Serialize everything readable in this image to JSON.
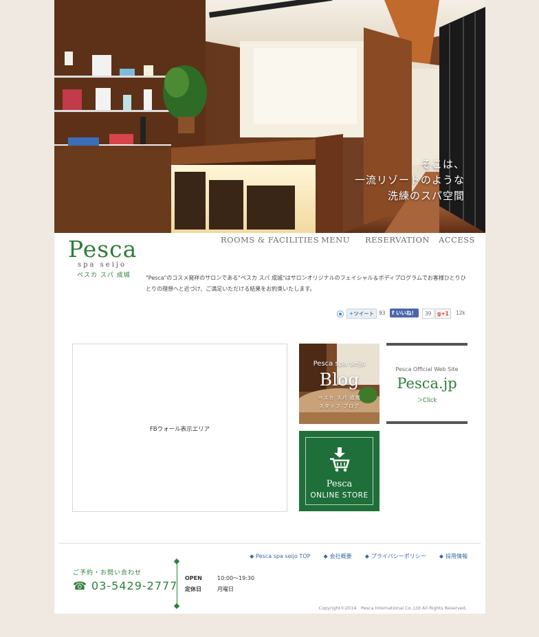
{
  "hero": {
    "tagline_line1": "そこは、",
    "tagline_line2": "一流リゾートのような",
    "tagline_line3": "洗練のスパ空間"
  },
  "logo": {
    "word": "Pesca",
    "sub": "spa seijo",
    "jp": "ペスカ スパ 成城"
  },
  "nav": {
    "items": [
      "ROOMS & FACILITIES",
      "MENU",
      "RESERVATION",
      "ACCESS"
    ]
  },
  "intro": {
    "text": "\"Pesca\"のコスメ発祥のサロンである\"ペスカ スパ 成城\"はサロンオリジナルのフェイシャル＆ボディプログラムでお客様ひとりひとりの理想へと近づけ、ご満足いただける結果をお約束いたします。"
  },
  "social": {
    "tweet_label": "ツイート",
    "tweet_count": "93",
    "like_label": "いいね！",
    "like_count": "39",
    "gplus_label": "+1",
    "gplus_count": "12k"
  },
  "fb_area": {
    "label": "FBウォール表示エリア"
  },
  "blog": {
    "line1": "Pesca spa seijo",
    "title": "Blog",
    "line3": "ペスカ スパ 成城",
    "line4": "スタッフ ブログ"
  },
  "official": {
    "label": "Pesca Official Web Site",
    "domain": "Pesca.jp",
    "click": "＞Click"
  },
  "store": {
    "line1": "Pesca",
    "line2": "ONLINE STORE"
  },
  "footer": {
    "links": [
      "Pesca spa seijo TOP",
      "会社概要",
      "プライバシーポリシー",
      "採用情報"
    ],
    "contact_label": "ご予約・お問い合わせ",
    "tel": "03-5429-2777",
    "open_label": "OPEN",
    "open_value": "10:00～19:30",
    "closed_label": "定休日",
    "closed_value": "月曜日",
    "copyright": "Copyright©2014　Pesca International Co.,Ltd All Rights Reserved."
  },
  "colors": {
    "brand_green": "#2f7d3b",
    "store_green": "#1e6f3a",
    "link_blue": "#3a6aa8",
    "page_bg": "#efe9e2"
  }
}
